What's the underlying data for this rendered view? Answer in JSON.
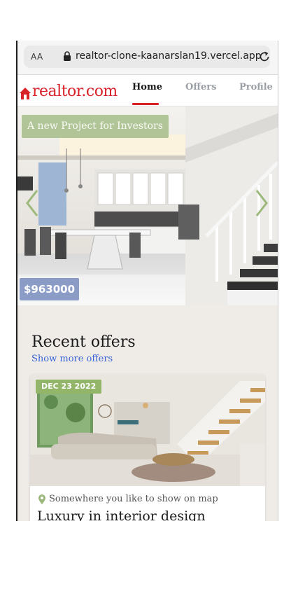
{
  "browser": {
    "text_size_label": "AA",
    "url": "realtor-clone-kaanarslan19.vercel.app"
  },
  "header": {
    "logo_text": "realtor.com",
    "nav": [
      "Home",
      "Offers",
      "Profile"
    ],
    "active_tab": "Home"
  },
  "hero": {
    "tag": "A new Project for Investors",
    "price": "$963000"
  },
  "recent": {
    "title": "Recent offers",
    "show_more": "Show more offers",
    "card": {
      "date": "DEC 23 2022",
      "location": "Somewhere you like to show on map",
      "title": "Luxury in interior design"
    }
  },
  "colors": {
    "brand_red": "#d92228",
    "tag_green": "#a6be8c",
    "badge_green": "#93b56a",
    "price_blue": "#788cbe",
    "link_blue": "#3b63d8",
    "page_bg": "#efece8"
  }
}
